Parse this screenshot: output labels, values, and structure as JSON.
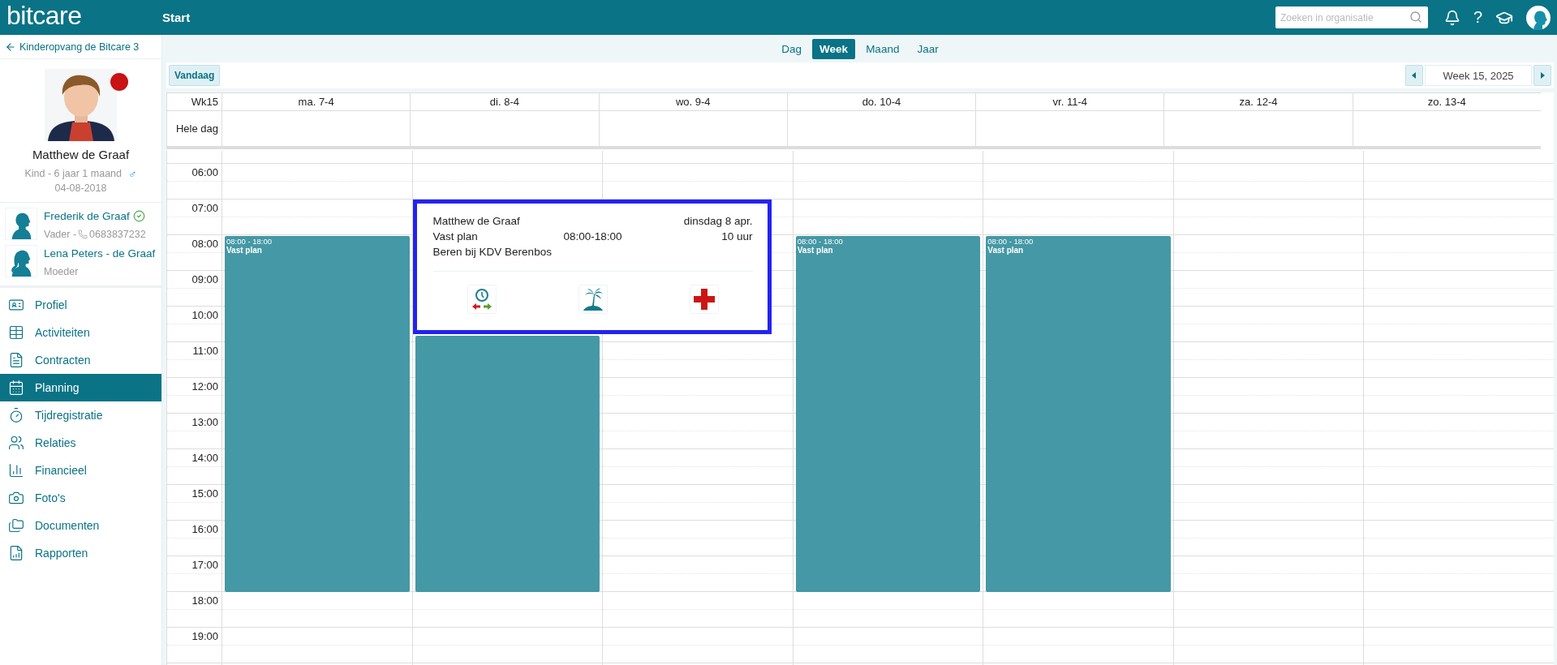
{
  "top_bar": {
    "logo": "bitcare",
    "title": "Start",
    "search": {
      "placeholder": "Zoeken in organisatie"
    },
    "help": "?"
  },
  "sidebar": {
    "back_link": "Kinderopvang de Bitcare 3",
    "child": {
      "name": "Matthew de Graaf",
      "description": "Kind - 6 jaar 1 maand",
      "gender_symbol": "♂",
      "birth_date": "04-08-2018"
    },
    "relations": [
      {
        "name": "Frederik de Graaf",
        "verified": true,
        "role": "Vader -",
        "phone": "0683837232"
      },
      {
        "name": "Lena Peters - de Graaf",
        "verified": false,
        "role": "Moeder"
      }
    ],
    "items": [
      {
        "label": "Profiel",
        "selected": false
      },
      {
        "label": "Activiteiten",
        "selected": false
      },
      {
        "label": "Contracten",
        "selected": false
      },
      {
        "label": "Planning",
        "selected": true
      },
      {
        "label": "Tijdregistratie",
        "selected": false
      },
      {
        "label": "Relaties",
        "selected": false
      },
      {
        "label": "Financieel",
        "selected": false
      },
      {
        "label": "Foto's",
        "selected": false
      },
      {
        "label": "Documenten",
        "selected": false
      },
      {
        "label": "Rapporten",
        "selected": false
      }
    ]
  },
  "view_tabs": [
    {
      "label": "Dag",
      "selected": false
    },
    {
      "label": "Week",
      "selected": true
    },
    {
      "label": "Maand",
      "selected": false
    },
    {
      "label": "Jaar",
      "selected": false
    }
  ],
  "toolbar": {
    "today_button": "Vandaag",
    "period": "Week 15, 2025"
  },
  "calendar": {
    "week_label": "Wk15",
    "all_day_label": "Hele dag",
    "hours": [
      "06:00",
      "07:00",
      "08:00",
      "09:00",
      "10:00",
      "11:00",
      "12:00",
      "13:00",
      "14:00",
      "15:00",
      "16:00",
      "17:00",
      "18:00",
      "19:00"
    ],
    "days": [
      {
        "label": "ma. 7-4",
        "event": {
          "time": "08:00 - 18:00",
          "label": "Vast plan"
        }
      },
      {
        "label": "di. 8-4",
        "event": {
          "popup": {
            "name": "Matthew de Graaf",
            "date": "dinsdag 8 apr.",
            "plan": "Vast plan",
            "time": "08:00-18:00",
            "duration": "10 uur",
            "group": "Beren bij KDV Berenbos"
          }
        }
      },
      {
        "label": "wo. 9-4"
      },
      {
        "label": "do. 10-4",
        "event": {
          "time": "08:00 - 18:00",
          "label": "Vast plan"
        }
      },
      {
        "label": "vr. 11-4",
        "event": {
          "time": "08:00 - 18:00",
          "label": "Vast plan"
        }
      },
      {
        "label": "za. 12-4"
      },
      {
        "label": "zo. 13-4"
      }
    ]
  }
}
